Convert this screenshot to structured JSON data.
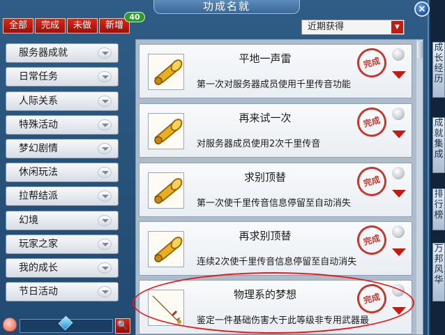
{
  "window": {
    "title": "功成名就",
    "close_label": "×"
  },
  "filters": {
    "tabs": [
      "全部",
      "完成",
      "未做",
      "新增"
    ],
    "new_count": "40"
  },
  "sort": {
    "selected": "近期获得",
    "arrow": "▼"
  },
  "sidebar": {
    "items": [
      {
        "label": "服务器成就"
      },
      {
        "label": "日常任务"
      },
      {
        "label": "人际关系"
      },
      {
        "label": "特殊活动"
      },
      {
        "label": "梦幻剧情"
      },
      {
        "label": "休闲玩法"
      },
      {
        "label": "拉帮结派"
      },
      {
        "label": "幻境"
      },
      {
        "label": "玩家之家"
      },
      {
        "label": "我的成长"
      },
      {
        "label": "节日活动"
      }
    ]
  },
  "search": {
    "button_label": "🔍"
  },
  "achievements": [
    {
      "title": "平地一声雷",
      "desc": "第一次对服务器成员使用千里传音功能",
      "icon": "horn-icon",
      "stamp": "完成"
    },
    {
      "title": "再来试一次",
      "desc": "对服务器成员使用2次千里传音",
      "icon": "horn-icon",
      "stamp": "完成"
    },
    {
      "title": "求别顶替",
      "desc": "第一次使千里传音信息停留至自动消失",
      "icon": "horn-icon",
      "stamp": "完成"
    },
    {
      "title": "再求别顶替",
      "desc": "连续2次使千里传音信息停留至自动消失",
      "icon": "horn-icon",
      "stamp": "完成"
    },
    {
      "title": "物理系的梦想",
      "desc": "鉴定一件基础伤害大于此等级非专用武器最",
      "icon": "sword-icon",
      "stamp": "完成"
    }
  ],
  "right_panel": [
    {
      "text": "成长经历"
    },
    {
      "text": "成就集成"
    },
    {
      "text": "排行榜"
    },
    {
      "text": "万邦风华"
    }
  ],
  "colors": {
    "accent_red": "#c0241a",
    "frame_blue": "#2f5d86",
    "badge_green": "#2e9c2a"
  }
}
